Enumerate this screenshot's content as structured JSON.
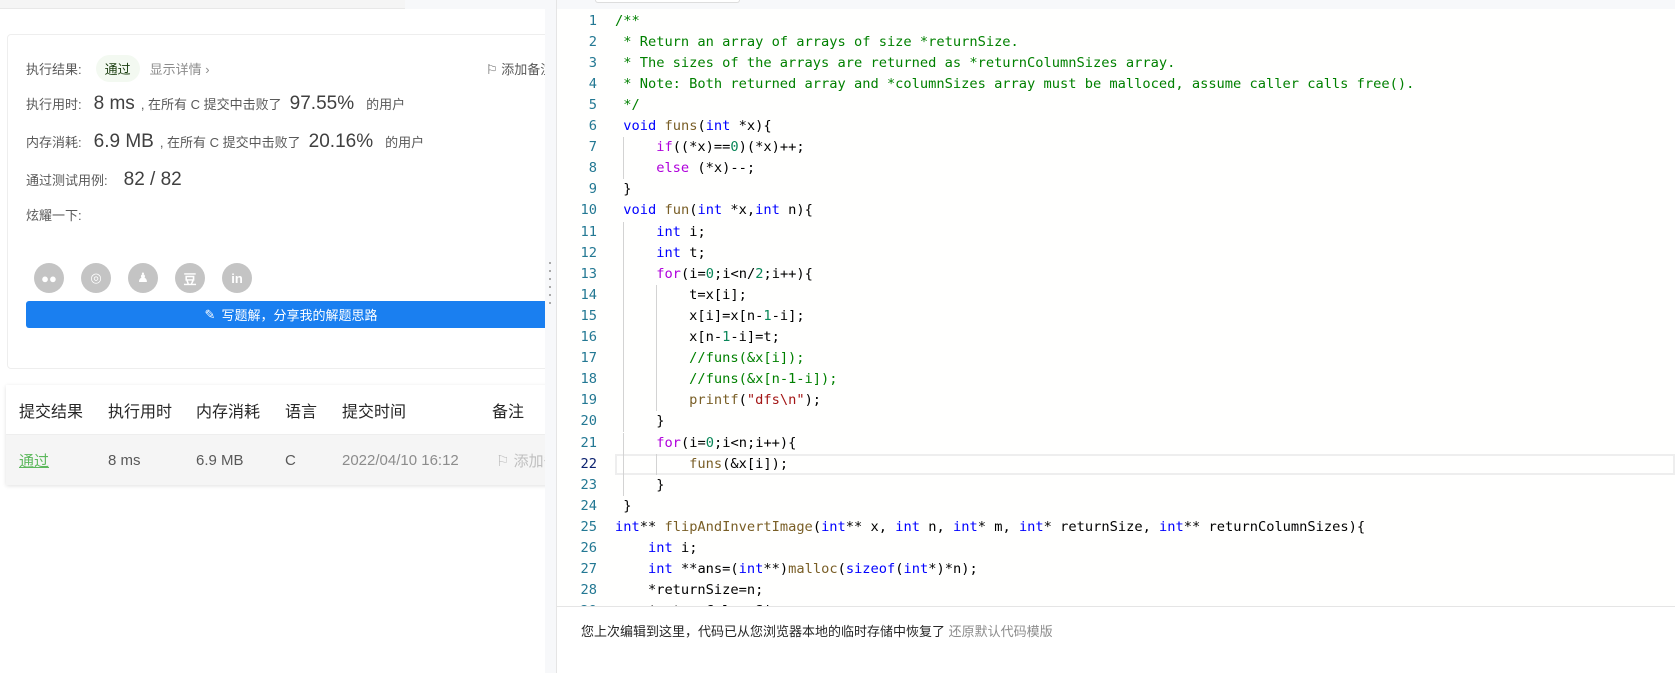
{
  "result": {
    "status_label": "执行结果:",
    "status": "通过",
    "details_link": "显示详情 ›",
    "add_note": "添加备注",
    "runtime_label": "执行用时:",
    "runtime": "8 ms",
    "beat_text": ", 在所有 C 提交中击败了",
    "runtime_pct": "97.55%",
    "users": "的用户",
    "memory_label": "内存消耗:",
    "memory": "6.9 MB",
    "memory_pct": "20.16%",
    "tests_label": "通过测试用例:",
    "tests": "82 / 82",
    "share_label": "炫耀一下:",
    "share_icons": [
      "wechat-icon",
      "weibo-icon",
      "qq-icon",
      "douban-icon",
      "linkedin-icon"
    ],
    "share_glyphs": [
      "●●",
      "◎",
      "♟",
      "豆",
      "in"
    ],
    "write_button": "写题解，分享我的解题思路"
  },
  "table": {
    "headers": [
      "提交结果",
      "执行用时",
      "内存消耗",
      "语言",
      "提交时间",
      "备注"
    ],
    "rows": [
      {
        "result": "通过",
        "runtime": "8 ms",
        "memory": "6.9 MB",
        "lang": "C",
        "time": "2022/04/10 16:12",
        "note": "添加备注"
      }
    ]
  },
  "editor": {
    "current_line": 22,
    "lines": [
      "/**",
      " * Return an array of arrays of size *returnSize.",
      " * The sizes of the arrays are returned as *returnColumnSizes array.",
      " * Note: Both returned array and *columnSizes array must be malloced, assume caller calls free().",
      " */",
      " void funs(int *x){",
      "     if((*x)==0)(*x)++;",
      "     else (*x)--;",
      " }",
      " void fun(int *x,int n){",
      "     int i;",
      "     int t;",
      "     for(i=0;i<n/2;i++){",
      "         t=x[i];",
      "         x[i]=x[n-1-i];",
      "         x[n-1-i]=t;",
      "         //funs(&x[i]);",
      "         //funs(&x[n-1-i]);",
      "         printf(\"dfs\\n\");",
      "     }",
      "     for(i=0;i<n;i++){",
      "         funs(&x[i]);",
      "     }",
      " }",
      "int** flipAndInvertImage(int** x, int n, int* m, int* returnSize, int** returnColumnSizes){",
      "    int i;",
      "    int **ans=(int**)malloc(sizeof(int*)*n);",
      "    *returnSize=n;",
      "    *returnColumnSizes"
    ]
  },
  "notice": {
    "text": "您上次编辑到这里，代码已从您浏览器本地的临时存储中恢复了",
    "restore_link": "还原默认代码模版"
  }
}
